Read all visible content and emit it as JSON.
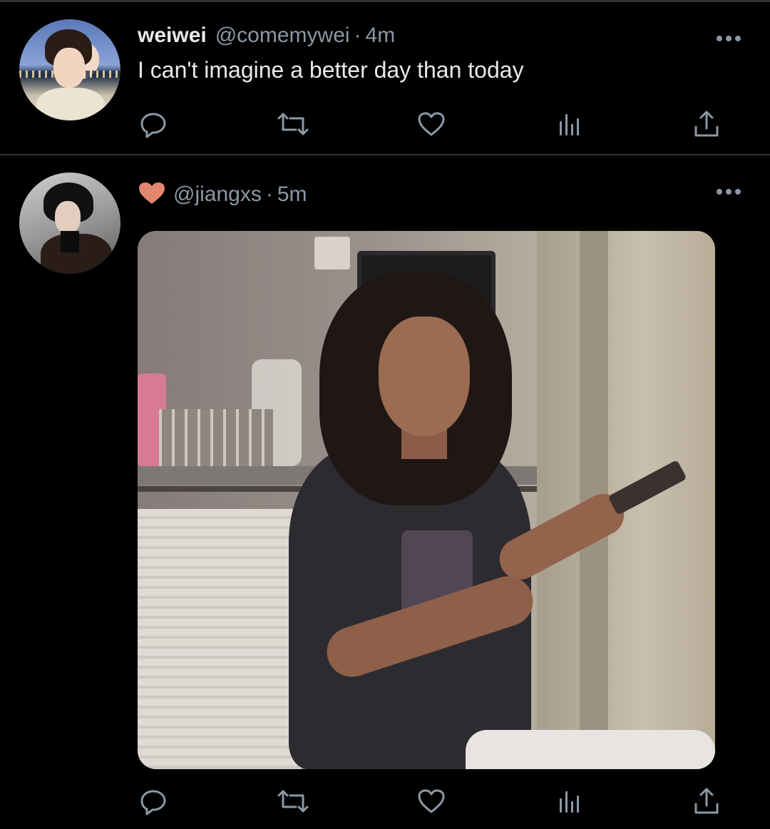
{
  "theme": {
    "background": "#000000",
    "text_primary": "#e7e9ea",
    "text_secondary": "#8b98a5",
    "divider": "#2f3336",
    "like_badge_color": "#e2876f"
  },
  "tweets": [
    {
      "display_name": "weiwei",
      "handle": "@comemywei",
      "separator": "·",
      "time": "4m",
      "text": "I can't imagine a better day than today",
      "avatar": "profile-photo",
      "actions": [
        "reply-icon",
        "retweet-icon",
        "like-icon",
        "views-icon",
        "share-icon"
      ],
      "more": "more-options-icon"
    },
    {
      "liked_badge": "heart-icon",
      "handle": "@jiangxs",
      "separator": "·",
      "time": "5m",
      "media": "photo",
      "avatar": "profile-photo",
      "actions": [
        "reply-icon",
        "retweet-icon",
        "like-icon",
        "views-icon",
        "share-icon"
      ],
      "more": "more-options-icon"
    }
  ]
}
